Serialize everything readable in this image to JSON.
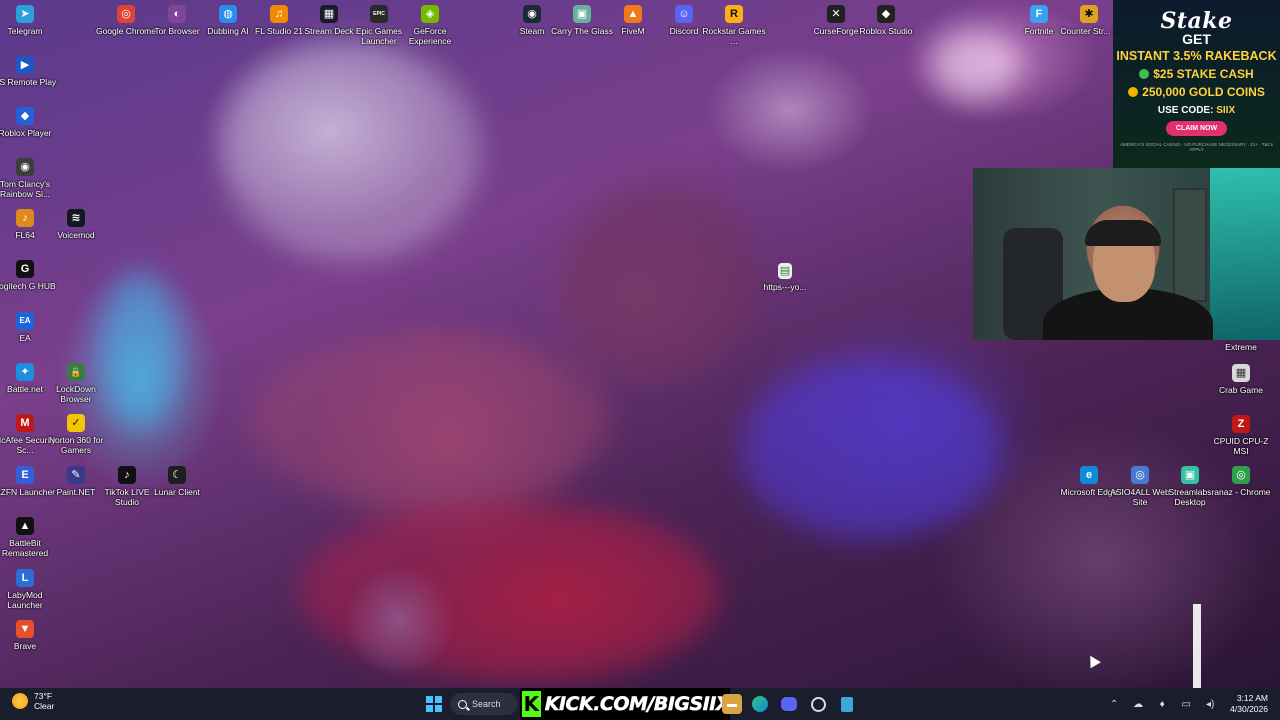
{
  "desktop": {
    "icons": [
      {
        "label": "Telegram",
        "color": "#2aa1da",
        "glyph": "➤",
        "icon": "telegram-icon"
      },
      {
        "label": "PS Remote Play",
        "color": "#1c57c2",
        "glyph": "▶",
        "icon": "ps-remote-play-icon"
      },
      {
        "label": "Roblox Player",
        "color": "#2460d6",
        "glyph": "◆",
        "icon": "roblox-player-icon"
      },
      {
        "label": "Tom Clancy's Rainbow Si...",
        "color": "#3d3d3d",
        "glyph": "◉",
        "icon": "rainbow-six-icon"
      },
      {
        "label": "FL64",
        "color": "#e08a1a",
        "glyph": "♪",
        "icon": "fl64-icon"
      },
      {
        "label": "Voicemod",
        "color": "#101822",
        "glyph": "≋",
        "icon": "voicemod-icon"
      },
      {
        "label": "Logitech G HUB",
        "color": "#111111",
        "glyph": "G",
        "icon": "logitech-ghub-icon"
      },
      {
        "label": "EA",
        "color": "#1d64d8",
        "glyph": "EA",
        "icon": "ea-icon"
      },
      {
        "label": "Battle.net",
        "color": "#1b8fe0",
        "glyph": "✦",
        "icon": "battlenet-icon"
      },
      {
        "label": "LockDown Browser",
        "color": "#3a7d44",
        "glyph": "🔒",
        "icon": "lockdown-browser-icon"
      },
      {
        "label": "McAfee Security Sc...",
        "color": "#c01818",
        "glyph": "M",
        "icon": "mcafee-icon"
      },
      {
        "label": "Norton 360 for Gamers",
        "color": "#f5c400",
        "glyph": "✓",
        "icon": "norton-icon"
      },
      {
        "label": "EZFN Launcher",
        "color": "#3160d8",
        "glyph": "E",
        "icon": "ezfn-icon"
      },
      {
        "label": "Paint.NET",
        "color": "#3a3a8c",
        "glyph": "✎",
        "icon": "paintnet-icon"
      },
      {
        "label": "TikTok LIVE Studio",
        "color": "#111111",
        "glyph": "♪",
        "icon": "tiktok-icon"
      },
      {
        "label": "Lunar Client",
        "color": "#1e1e1e",
        "glyph": "☾",
        "icon": "lunar-client-icon"
      },
      {
        "label": "BattleBit Remastered",
        "color": "#111111",
        "glyph": "▲",
        "icon": "battlebit-icon"
      },
      {
        "label": "LabyMod Launcher",
        "color": "#2a6fd8",
        "glyph": "L",
        "icon": "labymod-icon"
      },
      {
        "label": "Brave",
        "color": "#e8502b",
        "glyph": "▼",
        "icon": "brave-icon"
      },
      {
        "label": "Google Chrome",
        "color": "#db4437",
        "glyph": "◎",
        "icon": "chrome-icon"
      },
      {
        "label": "Tor Browser",
        "color": "#7d4698",
        "glyph": "◐",
        "icon": "tor-browser-icon"
      },
      {
        "label": "Dubbing AI",
        "color": "#2a8cf0",
        "glyph": "◍",
        "icon": "dubbing-ai-icon"
      },
      {
        "label": "FL Studio 21",
        "color": "#f08a00",
        "glyph": "♫",
        "icon": "fl-studio-icon"
      },
      {
        "label": "Stream Deck",
        "color": "#1a1a2a",
        "glyph": "▦",
        "icon": "stream-deck-icon"
      },
      {
        "label": "Epic Games Launcher",
        "color": "#2a2a2a",
        "glyph": "EPIC",
        "icon": "epic-games-icon"
      },
      {
        "label": "GeForce Experience",
        "color": "#76b900",
        "glyph": "◈",
        "icon": "geforce-icon"
      },
      {
        "label": "Steam",
        "color": "#1b2838",
        "glyph": "◉",
        "icon": "steam-icon"
      },
      {
        "label": "Carry The Glass",
        "color": "#6ab0a0",
        "glyph": "▣",
        "icon": "carry-the-glass-icon"
      },
      {
        "label": "FiveM",
        "color": "#f07a1a",
        "glyph": "▲",
        "icon": "fivem-icon"
      },
      {
        "label": "Discord",
        "color": "#5865f2",
        "glyph": "☺",
        "icon": "discord-icon"
      },
      {
        "label": "Rockstar Games ...",
        "color": "#fcaf17",
        "glyph": "R",
        "icon": "rockstar-icon"
      },
      {
        "label": "CurseForge",
        "color": "#202020",
        "glyph": "✕",
        "icon": "curseforge-icon"
      },
      {
        "label": "Roblox Studio",
        "color": "#222222",
        "glyph": "◆",
        "icon": "roblox-studio-icon"
      },
      {
        "label": "Fortnite",
        "color": "#3aa0f0",
        "glyph": "F",
        "icon": "fortnite-icon"
      },
      {
        "label": "Counter Str... 2",
        "color": "#e0a020",
        "glyph": "✱",
        "icon": "counter-strike-icon"
      },
      {
        "label": "https---yo...",
        "color": "#eeeeee",
        "glyph": "▤",
        "icon": "url-shortcut-icon"
      },
      {
        "label": "Extreme",
        "color": "#333333",
        "glyph": "",
        "icon": "extreme-icon"
      },
      {
        "label": "Crab Game",
        "color": "#d8d8d8",
        "glyph": "▦",
        "icon": "crab-game-icon"
      },
      {
        "label": "CPUID CPU-Z MSI",
        "color": "#c01818",
        "glyph": "Z",
        "icon": "cpuz-icon"
      },
      {
        "label": "Microsoft Edge",
        "color": "#0f8bd6",
        "glyph": "e",
        "icon": "edge-icon"
      },
      {
        "label": "ASIO4ALL Web Site",
        "color": "#4a7ad0",
        "glyph": "◎",
        "icon": "asio4all-icon"
      },
      {
        "label": "Streamlabs Desktop",
        "color": "#31c3a2",
        "glyph": "▣",
        "icon": "streamlabs-icon"
      },
      {
        "label": "ranaz - Chrome",
        "color": "#2fa04a",
        "glyph": "◎",
        "icon": "chrome-profile-icon"
      }
    ]
  },
  "stake_ad": {
    "brand": "Stake",
    "get": "GET",
    "rakeback": "INSTANT 3.5% RAKEBACK",
    "cash": "$25 STAKE CASH",
    "gold": "250,000 GOLD COINS",
    "code_label": "USE CODE:",
    "code": "SIIX",
    "claim": "CLAIM NOW",
    "fine_print": "AMERICA'S SOCIAL CASINO · NO PURCHASE NECESSARY · 21+ · T&Cs APPLY"
  },
  "taskbar": {
    "weather_temp": "73°F",
    "weather_desc": "Clear",
    "search_label": "Search",
    "kick_url": "KICK.COM/BIGSIIX",
    "time": "3:12 AM",
    "date": "4/30/2026"
  },
  "colors": {
    "taskbar_bg": "#1a1d2b",
    "kick_green": "#53fc18",
    "stake_gold": "#ffd23c",
    "claim_pink": "#e1306c"
  }
}
